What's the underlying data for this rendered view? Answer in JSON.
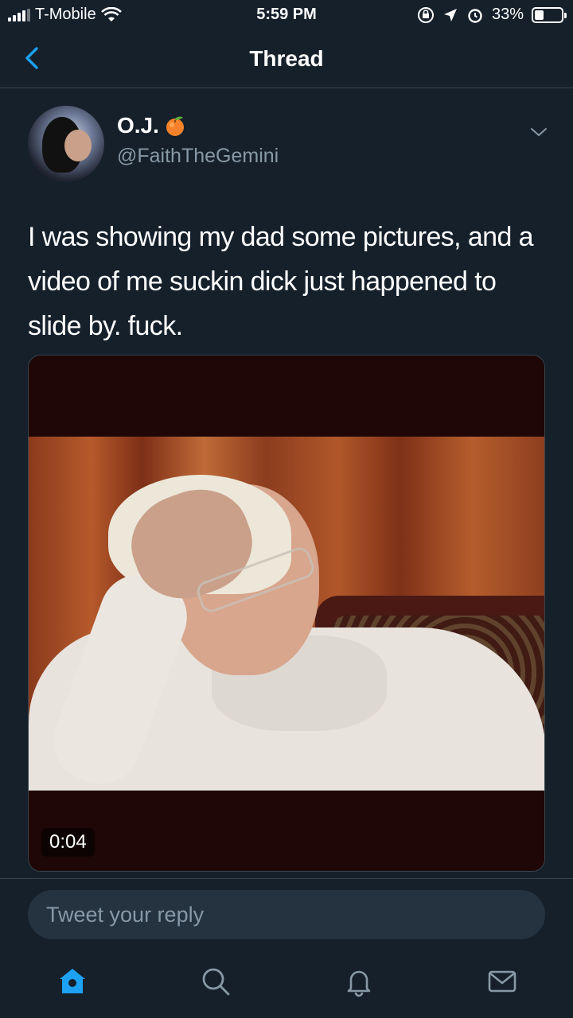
{
  "status_bar": {
    "carrier": "T-Mobile",
    "time": "5:59 PM",
    "battery": "33%",
    "battery_level": 0.33
  },
  "nav": {
    "title": "Thread",
    "back_icon": "chevron-left-icon"
  },
  "tweet": {
    "display_name": "O.J.",
    "name_emoji": "peach-icon",
    "handle": "@FaithTheGemini",
    "text": "I was showing my dad some pictures, and a video of me suckin dick just happened to slide by. fuck.",
    "media": {
      "duration": "0:04"
    }
  },
  "reply": {
    "placeholder": "Tweet your reply"
  },
  "tabs": [
    {
      "icon": "home-icon",
      "active": true
    },
    {
      "icon": "search-icon",
      "active": false
    },
    {
      "icon": "notifications-icon",
      "active": false
    },
    {
      "icon": "messages-icon",
      "active": false
    }
  ],
  "colors": {
    "background": "#15202b",
    "accent": "#1da1f2",
    "secondary_text": "#8899a6",
    "divider": "#38444d"
  }
}
